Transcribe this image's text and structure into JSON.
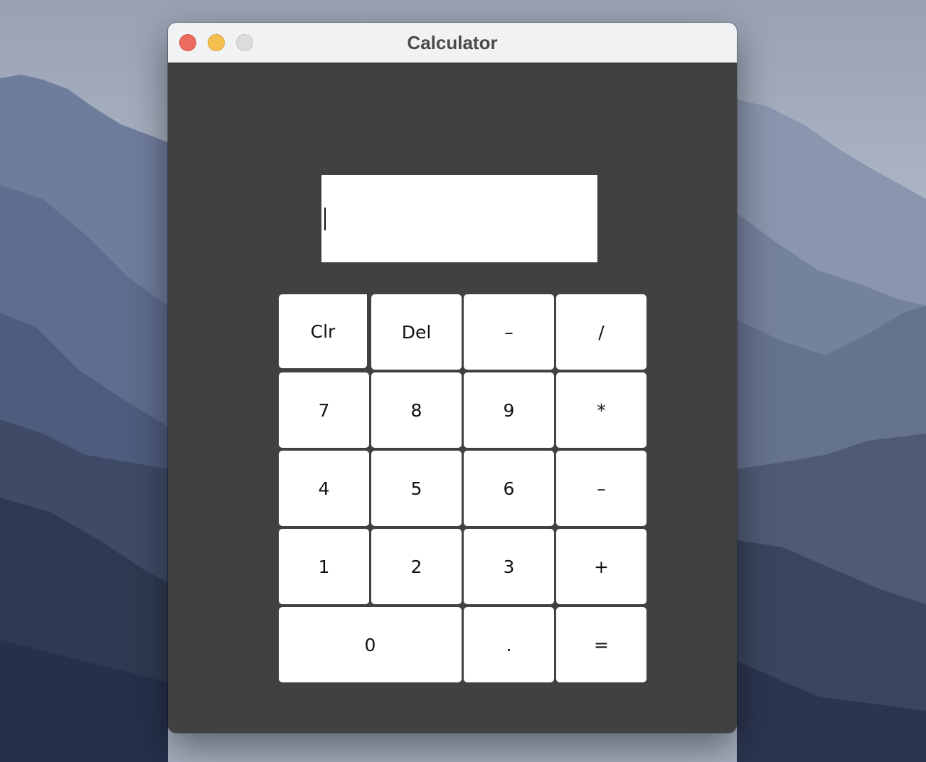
{
  "window": {
    "title": "Calculator"
  },
  "display": {
    "value": "",
    "placeholder": ""
  },
  "keypad": {
    "clear_label": "Clr",
    "delete_label": "Del",
    "negate_label": "–",
    "divide_label": "/",
    "seven_label": "7",
    "eight_label": "8",
    "nine_label": "9",
    "multiply_label": "*",
    "four_label": "4",
    "five_label": "5",
    "six_label": "6",
    "subtract_label": "–",
    "one_label": "1",
    "two_label": "2",
    "three_label": "3",
    "add_label": "+",
    "zero_label": "0",
    "decimal_label": ".",
    "equals_label": "="
  },
  "colors": {
    "window_background": "#414141",
    "titlebar_background": "#f1f2f4",
    "button_background": "#ffffff",
    "close": "#ed6a5e",
    "minimize": "#f5bf4f",
    "zoom_disabled": "#dcdcdd"
  },
  "icons": {
    "close": "close-icon",
    "minimize": "minimize-icon",
    "zoom": "zoom-icon"
  }
}
